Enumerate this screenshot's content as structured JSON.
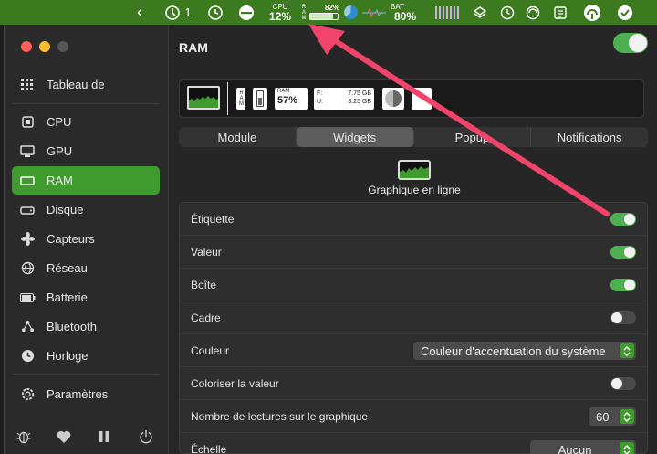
{
  "menubar": {
    "back": "‹",
    "sync_count": "1",
    "cpu_label": "CPU",
    "cpu_value": "12%",
    "ram_letters": "RAM",
    "ram_percent": "82%",
    "ram_fill": 0.82,
    "bat_label": "BAT",
    "bat_value": "80%"
  },
  "sidebar": {
    "items": [
      {
        "label": "Tableau de",
        "icon": "grid-icon"
      },
      {
        "label": "CPU",
        "icon": "cpu-icon"
      },
      {
        "label": "GPU",
        "icon": "gpu-icon"
      },
      {
        "label": "RAM",
        "icon": "ram-icon"
      },
      {
        "label": "Disque",
        "icon": "disk-icon"
      },
      {
        "label": "Capteurs",
        "icon": "fan-icon"
      },
      {
        "label": "Réseau",
        "icon": "globe-icon"
      },
      {
        "label": "Batterie",
        "icon": "battery-icon"
      },
      {
        "label": "Bluetooth",
        "icon": "bluetooth-icon"
      },
      {
        "label": "Horloge",
        "icon": "clock-icon"
      },
      {
        "label": "Paramètres",
        "icon": "gear-icon"
      }
    ]
  },
  "main": {
    "title": "RAM",
    "preview": {
      "ram_vertical": "RAM",
      "ram_label": "RAM",
      "ram_value": "57%",
      "free_label": "F:",
      "free_value": "7.75 GB",
      "used_label": "U:",
      "used_value": "8.25 GB"
    },
    "tabs": [
      "Module",
      "Widgets",
      "Popup",
      "Notifications"
    ],
    "widget_label": "Graphique en ligne",
    "settings": [
      {
        "label": "Étiquette",
        "toggle": true
      },
      {
        "label": "Valeur",
        "toggle": true
      },
      {
        "label": "Boîte",
        "toggle": true
      },
      {
        "label": "Cadre",
        "toggle": false
      },
      {
        "label": "Couleur",
        "select": "Couleur d'accentuation du système"
      },
      {
        "label": "Coloriser la valeur",
        "toggle": false
      },
      {
        "label": "Nombre de lectures sur le graphique",
        "select": "60"
      },
      {
        "label": "Échelle",
        "select": "Aucun"
      }
    ]
  },
  "colors": {
    "accent": "#3f9b2e",
    "menubar": "#3b7a1f",
    "arrow": "#f0446b"
  }
}
